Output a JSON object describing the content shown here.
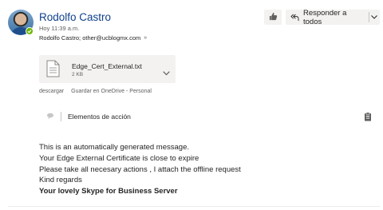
{
  "header": {
    "sender_name": "Rodolfo Castro",
    "time": "Hoy 11:39 a.m.",
    "recipients": "Rodolfo Castro; other@ucblogmx.com",
    "recipients_expand_glyph": "»"
  },
  "toolbar": {
    "reply_all_label": "Responder a todos",
    "reply_icon": "reply-all-icon",
    "react_icon": "thumbs-up-icon",
    "more_icon": "chevron-down-icon"
  },
  "attachment": {
    "file_name": "Edge_Cert_External.txt",
    "file_size": "2 KB",
    "download_label": "descargar",
    "save_onedrive_label": "Guardar en OneDrive - Personal"
  },
  "action_items": {
    "label": "Elementos de acción"
  },
  "message": {
    "lines": [
      "This is an automatically generated message.",
      "Your Edge External Certificate is close to expire",
      "Please take all necesary actions , I attach the offline request",
      "Kind regards"
    ],
    "signature": "Your lovely Skype for Business Server"
  },
  "colors": {
    "sender_blue": "#0f3f8c",
    "presence_green": "#6bb700",
    "button_gray": "#f3f2f1"
  }
}
